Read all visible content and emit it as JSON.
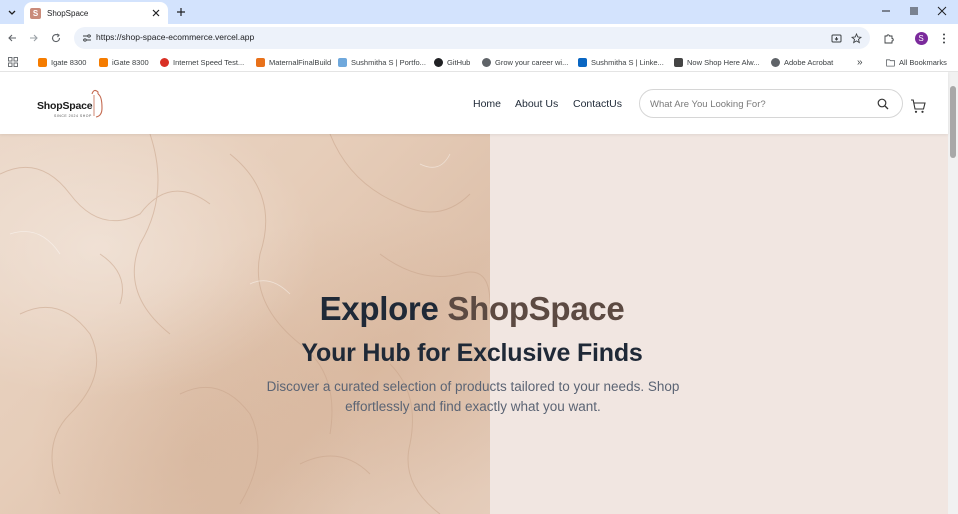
{
  "browser": {
    "tab_title": "ShopSpace",
    "tab_favicon_letter": "S",
    "url": "https://shop-space-ecommerce.vercel.app",
    "profile_initial": "S"
  },
  "bookmarks": [
    {
      "label": "Igate 8300",
      "color": "#f57c00"
    },
    {
      "label": "iGate 8300",
      "color": "#f57c00"
    },
    {
      "label": "Internet Speed Test...",
      "color": "#d93025"
    },
    {
      "label": "MaternalFinalBuild",
      "color": "#e8711a"
    },
    {
      "label": "Sushmitha S | Portfo...",
      "color": "#6fa8dc"
    },
    {
      "label": "GitHub",
      "color": "#202124"
    },
    {
      "label": "Grow your career wi...",
      "color": "#5f6368"
    },
    {
      "label": "Sushmitha S | Linke...",
      "color": "#0a66c2"
    },
    {
      "label": "Now Shop Here Alw...",
      "color": "#444444"
    },
    {
      "label": "Adobe Acrobat",
      "color": "#5f6368"
    }
  ],
  "bookmarks_more": "»",
  "all_bookmarks": "All Bookmarks",
  "site": {
    "logo_text": "ShopSpace",
    "logo_tagline": "SINCE 2024 SHOP",
    "nav": [
      "Home",
      "About Us",
      "ContactUs"
    ],
    "search_placeholder": "What Are You Looking For?"
  },
  "hero": {
    "title_prefix": "Explore ",
    "title_accent": "ShopSpace",
    "subtitle": "Your Hub for Exclusive Finds",
    "description": "Discover a curated selection of products tailored to your needs. Shop effortlessly and find exactly what you want."
  },
  "colors": {
    "accent": "#5c4a42",
    "hero_bg": "#f1e6e1",
    "heading": "#1f2937"
  }
}
